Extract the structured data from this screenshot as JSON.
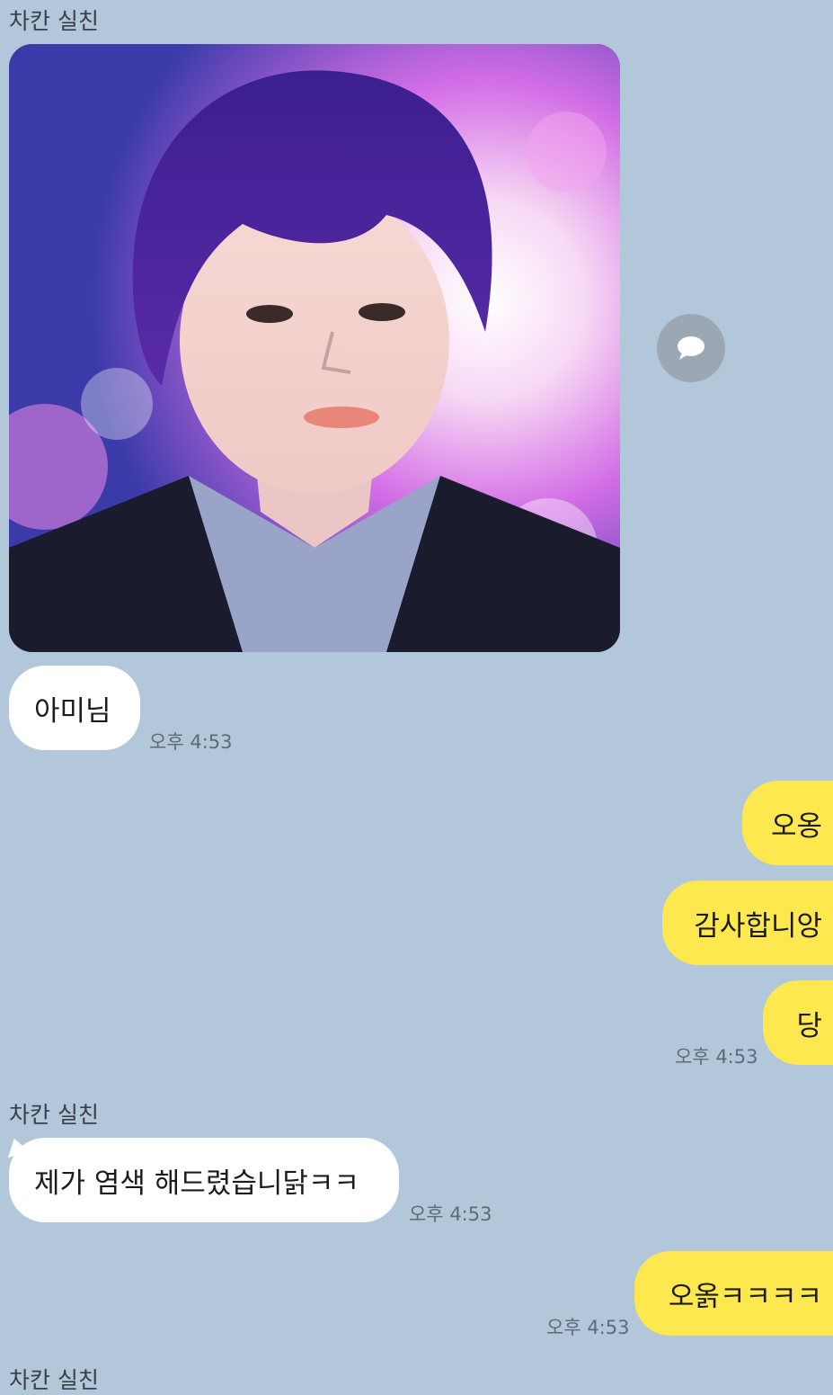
{
  "chat": {
    "sender_name": "차칸 실친",
    "messages": [
      {
        "text": "아미님",
        "time": "오후 4:53"
      },
      {
        "text": "오옹"
      },
      {
        "text": "감사합니앙"
      },
      {
        "text": "당",
        "time": "오후 4:53"
      },
      {
        "text": "제가 염색 해드렸습니닭ㅋㅋ",
        "time": "오후 4:53"
      },
      {
        "text": "오옭ㅋㅋㅋㅋ",
        "time": "오후 4:53"
      }
    ]
  },
  "colors": {
    "background": "#b2c7da",
    "incoming_bubble": "#ffffff",
    "outgoing_bubble": "#fde94f"
  },
  "icons": {
    "share": "speech-bubble-icon"
  }
}
